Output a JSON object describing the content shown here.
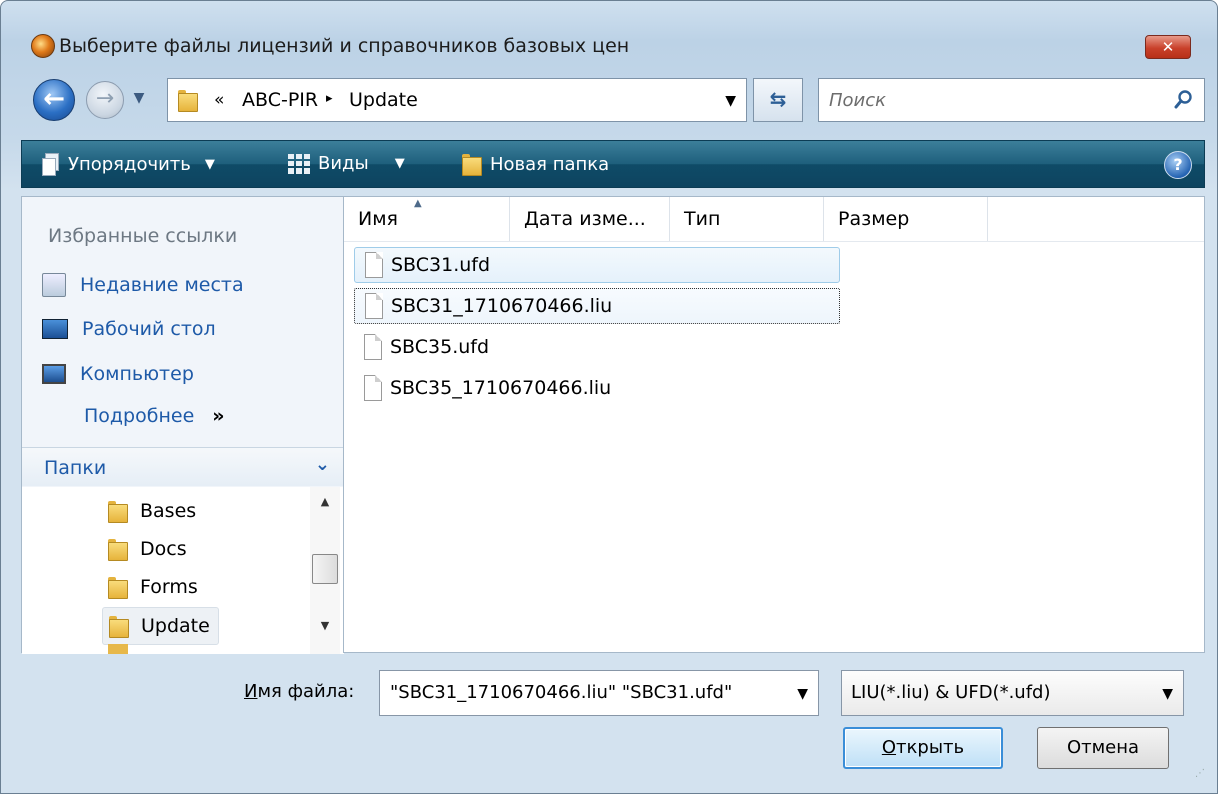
{
  "window": {
    "title": "Выберите файлы лицензий и справочников базовых цен"
  },
  "address": {
    "chevron": "«",
    "segments": [
      "ABC-PIR",
      "Update"
    ],
    "separator": "▸"
  },
  "search": {
    "placeholder": "Поиск"
  },
  "toolbar": {
    "organize_label": "Упорядочить",
    "views_label": "Виды",
    "new_folder_label": "Новая папка"
  },
  "favorites": {
    "title": "Избранные ссылки",
    "items": [
      {
        "label": "Недавние места",
        "icon": "recent-places-icon"
      },
      {
        "label": "Рабочий стол",
        "icon": "desktop-icon"
      },
      {
        "label": "Компьютер",
        "icon": "computer-icon"
      }
    ],
    "more_label": "Подробнее",
    "more_glyph": "»"
  },
  "folders": {
    "title": "Папки",
    "items": [
      {
        "label": "Bases",
        "selected": false
      },
      {
        "label": "Docs",
        "selected": false
      },
      {
        "label": "Forms",
        "selected": false
      },
      {
        "label": "Update",
        "selected": true
      }
    ]
  },
  "columns": [
    "Имя",
    "Дата изме...",
    "Тип",
    "Размер"
  ],
  "files": [
    {
      "name": "SBC31.ufd",
      "state": "selected"
    },
    {
      "name": "SBC31_1710670466.liu",
      "state": "focused"
    },
    {
      "name": "SBC35.ufd",
      "state": "normal"
    },
    {
      "name": "SBC35_1710670466.liu",
      "state": "normal"
    }
  ],
  "bottom": {
    "filename_label_mnemonic": "И",
    "filename_label_rest": "мя файла:",
    "filename_value": "\"SBC31_1710670466.liu\" \"SBC31.ufd\"",
    "filter_value": "LIU(*.liu) & UFD(*.ufd)",
    "open_mnemonic": "О",
    "open_rest": "ткрыть",
    "cancel_label": "Отмена"
  },
  "colors": {
    "toolbar": "#1e5f7c",
    "link": "#1e5aa8",
    "selection_border": "#9fcce9"
  }
}
